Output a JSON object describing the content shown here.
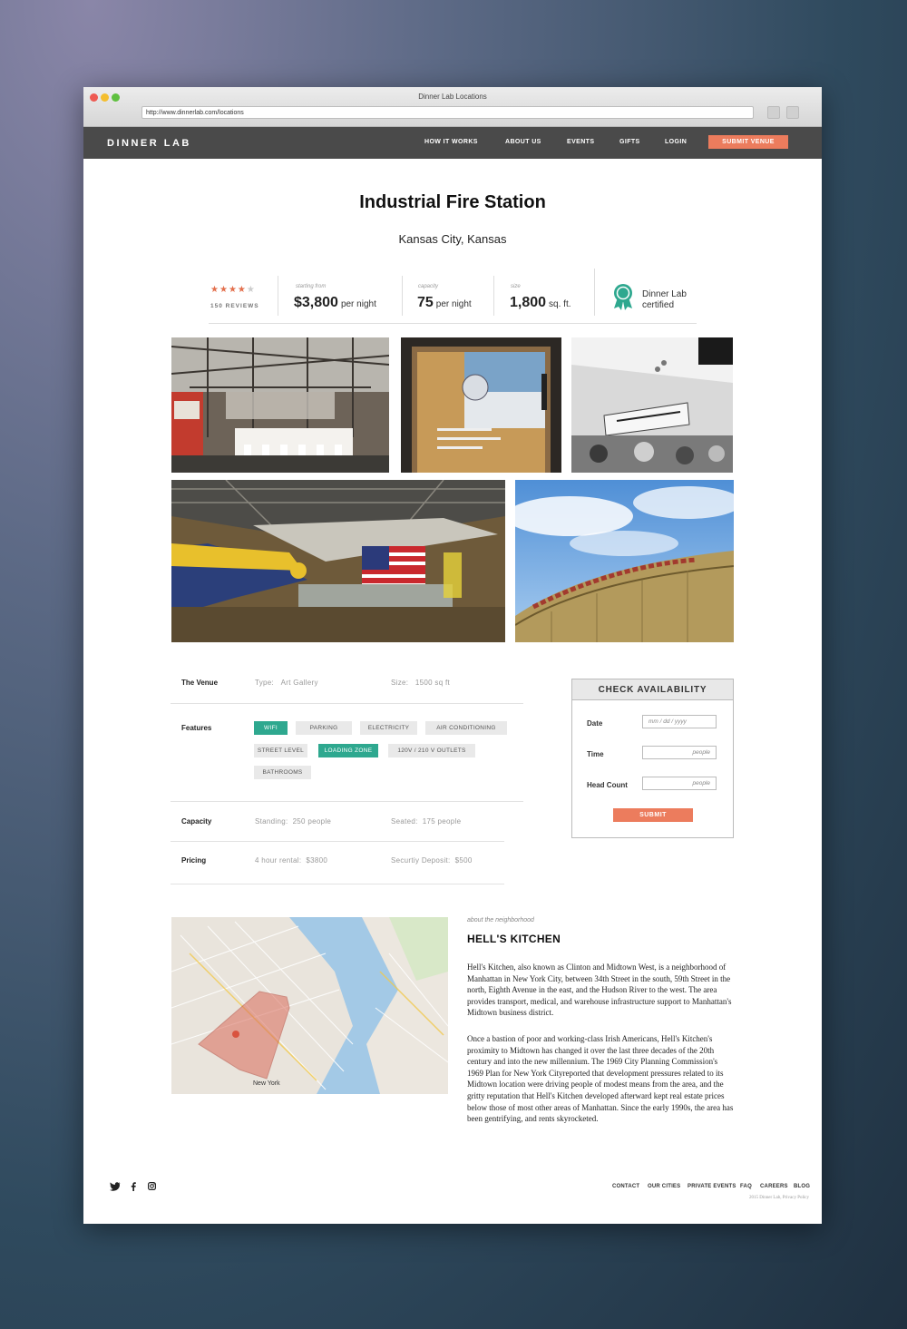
{
  "browser": {
    "window_title": "Dinner Lab Locations",
    "url": "http://www.dinnerlab.com/locations"
  },
  "nav": {
    "logo": "DINNER LAB",
    "links": [
      "HOW IT WORKS",
      "ABOUT US",
      "EVENTS",
      "GIFTS",
      "LOGIN"
    ],
    "cta": "SUBMIT VENUE"
  },
  "venue": {
    "title": "Industrial Fire Station",
    "location": "Kansas City, Kansas"
  },
  "stats": {
    "rating": 4,
    "rating_max": 5,
    "reviews": "150 REVIEWS",
    "price_label": "starting from",
    "price_value": "$3,800",
    "price_unit": "per night",
    "capacity_label": "capacity",
    "capacity_value": "75",
    "capacity_unit": "per night",
    "size_label": "size",
    "size_value": "1,800",
    "size_unit": "sq. ft.",
    "cert_line1": "Dinner Lab",
    "cert_line2": "certified",
    "cert_icon": "ribbon-badge-icon"
  },
  "details": {
    "venue_label": "The Venue",
    "type_key": "Type:",
    "type_val": "Art Gallery",
    "size_key": "Size:",
    "size_val": "1500 sq ft",
    "features_label": "Features",
    "features": [
      {
        "label": "WIFI",
        "on": true
      },
      {
        "label": "PARKING",
        "on": false
      },
      {
        "label": "ELECTRICITY",
        "on": false
      },
      {
        "label": "AIR CONDITIONING",
        "on": false
      },
      {
        "label": "STREET LEVEL",
        "on": false
      },
      {
        "label": "LOADING ZONE",
        "on": true
      },
      {
        "label": "120V / 210 V OUTLETS",
        "on": false
      },
      {
        "label": "BATHROOMS",
        "on": false
      }
    ],
    "capacity_label": "Capacity",
    "standing_key": "Standing:",
    "standing_val": "250 people",
    "seated_key": "Seated:",
    "seated_val": "175 people",
    "pricing_label": "Pricing",
    "rental_key": "4 hour rental:",
    "rental_val": "$3800",
    "deposit_key": "Securtiy Deposit:",
    "deposit_val": "$500"
  },
  "availability": {
    "title": "CHECK AVAILABILITY",
    "date_label": "Date",
    "date_placeholder": "mm / dd / yyyy",
    "time_label": "Time",
    "time_placeholder": "people",
    "head_label": "Head Count",
    "head_placeholder": "people",
    "submit": "SUBMIT"
  },
  "neighborhood": {
    "kicker": "about the neighborhood",
    "title": "HELL'S KITCHEN",
    "map_label": "New York",
    "p1": "Hell's Kitchen, also known as Clinton and Midtown West, is a neighborhood of Manhattan in New York City, between 34th Street in the south, 59th Street in the north, Eighth Avenue in the east, and the Hudson River to the west.  The area provides transport, medical, and warehouse infrastructure support to Manhattan's Midtown business district.",
    "p2": "Once a bastion of poor and working-class Irish Americans, Hell's Kitchen's proximity to Midtown has changed it over the last three decades of the 20th century and into the new millennium. The 1969 City Planning Commission's 1969 Plan for New York Cityreported that development pressures related to its Midtown location were driving people of modest means from the area, and the gritty reputation that Hell's Kitchen developed afterward kept real estate prices below those of most other areas of Manhattan. Since the early 1990s, the area has been gentrifying, and rents skyrocketed."
  },
  "footer": {
    "social": [
      "twitter-icon",
      "facebook-icon",
      "instagram-icon"
    ],
    "links": [
      "CONTACT",
      "OUR CITIES",
      "PRIVATE EVENTS",
      "FAQ",
      "CAREERS",
      "BLOG"
    ],
    "copyright": "2015 Dinner Lab, Privacy Policy"
  },
  "colors": {
    "accent": "#ec7c5d",
    "teal": "#2ea88f",
    "nav_bg": "#4a4a4a"
  }
}
